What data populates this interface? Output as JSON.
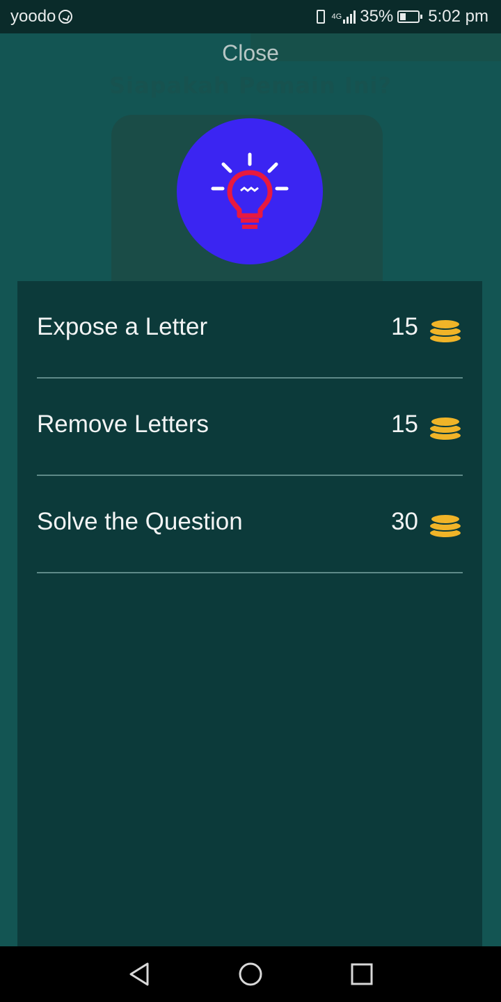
{
  "status_bar": {
    "carrier": "yoodo",
    "network": "4G",
    "battery": "35%",
    "battery_level": 0.35,
    "time": "5:02 pm"
  },
  "background": {
    "title": "Siapakah Pemain Ini?"
  },
  "dialog": {
    "close_label": "Close",
    "hint_icon": "lightbulb-icon",
    "options": [
      {
        "label": "Expose a Letter",
        "cost": "15",
        "icon": "coins-icon"
      },
      {
        "label": "Remove Letters",
        "cost": "15",
        "icon": "coins-icon"
      },
      {
        "label": "Solve the Question",
        "cost": "30",
        "icon": "coins-icon"
      }
    ]
  },
  "nav_bar": {
    "back_icon": "back-triangle-icon",
    "home_icon": "home-circle-icon",
    "recents_icon": "recents-square-icon"
  },
  "colors": {
    "hint_circle": "#3b25f2",
    "bulb": "#e8193f",
    "coin": "#f0b428",
    "panel": "#0c3a3a"
  }
}
